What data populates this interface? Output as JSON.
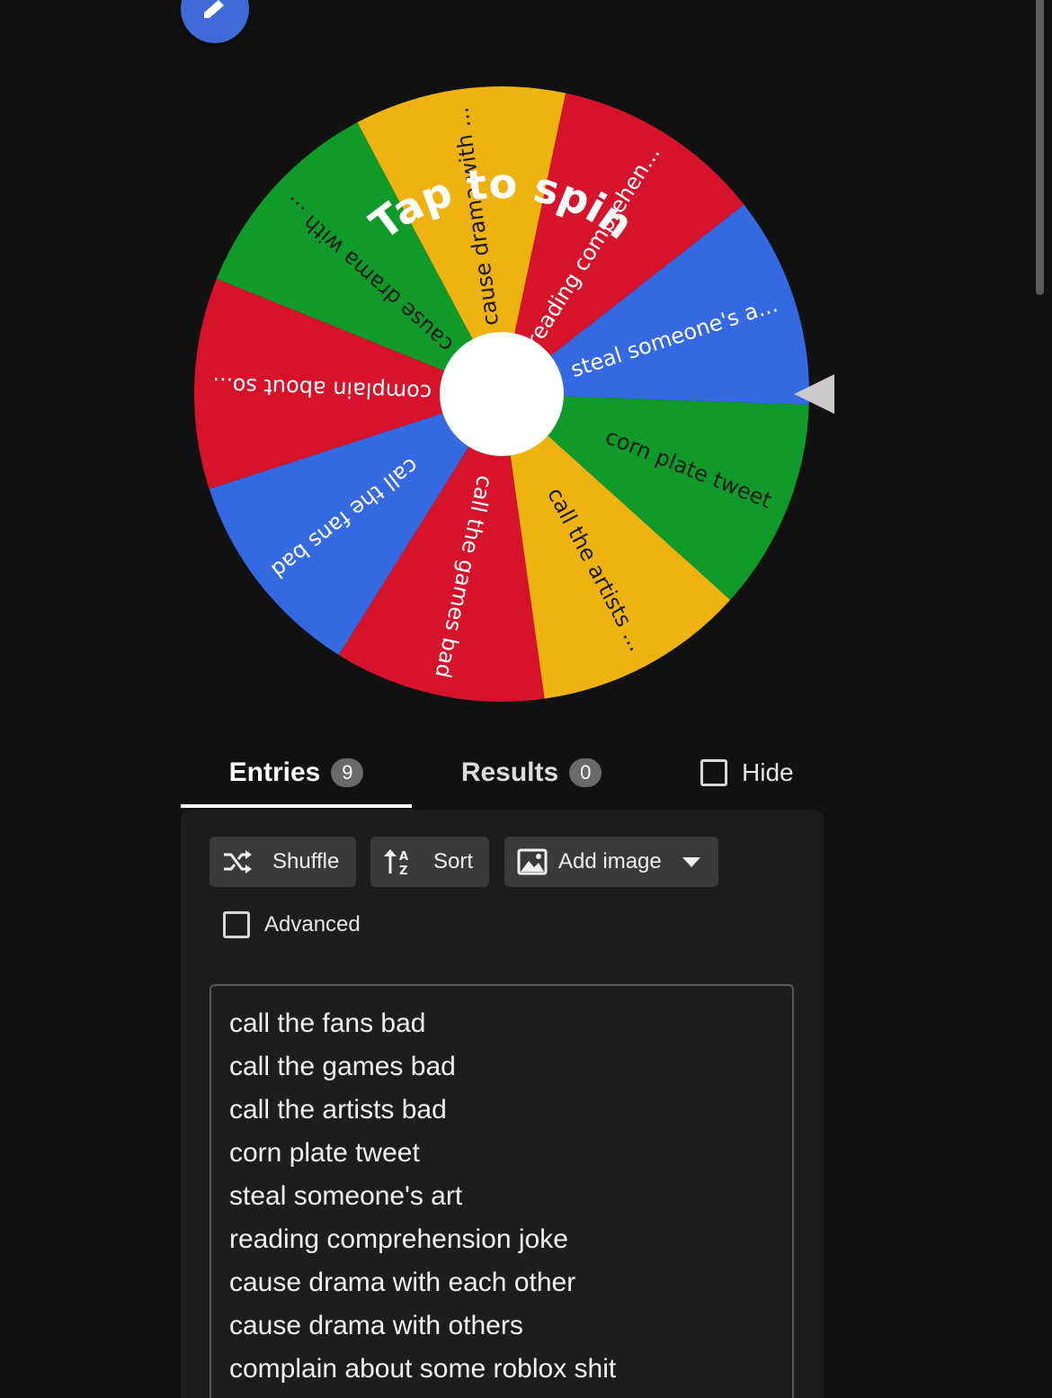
{
  "fab": {
    "icon": "pencil-icon"
  },
  "wheel": {
    "center_text": "Tap to spin",
    "pointer_icon": "triangle-pointer-icon",
    "colors": {
      "green": "#0f9a2a",
      "red": "#d6132a",
      "yellow": "#eeb211",
      "blue": "#3569e2",
      "hub": "#ffffff"
    },
    "segments": [
      {
        "label": "corn plate tweet",
        "color": "#0f9a2a",
        "text_color": "#1a1a1a"
      },
      {
        "label": "call the artists ...",
        "color": "#eeb211",
        "text_color": "#1a1a1a"
      },
      {
        "label": "call the games bad",
        "color": "#d6132a",
        "text_color": "#ffffff"
      },
      {
        "label": "call the fans bad",
        "color": "#3569e2",
        "text_color": "#ffffff"
      },
      {
        "label": "complain about so...",
        "color": "#d6132a",
        "text_color": "#ffffff"
      },
      {
        "label": "cause drama with ...",
        "color": "#0f9a2a",
        "text_color": "#1a1a1a"
      },
      {
        "label": "cause drama with ...",
        "color": "#eeb211",
        "text_color": "#1a1a1a"
      },
      {
        "label": "reading comprehen...",
        "color": "#d6132a",
        "text_color": "#ffffff"
      },
      {
        "label": "steal someone's a...",
        "color": "#3569e2",
        "text_color": "#ffffff"
      }
    ]
  },
  "tabs": {
    "entries_label": "Entries",
    "entries_count": "9",
    "results_label": "Results",
    "results_count": "0",
    "hide_label": "Hide"
  },
  "toolbar": {
    "shuffle_label": "Shuffle",
    "sort_label": "Sort",
    "add_image_label": "Add image",
    "advanced_label": "Advanced"
  },
  "entries": [
    "call the fans bad",
    "call the games bad",
    "call the artists bad",
    "corn plate tweet",
    "steal someone's art",
    "reading comprehension joke",
    "cause drama with each other",
    "cause drama with others",
    "complain about some roblox shit"
  ]
}
